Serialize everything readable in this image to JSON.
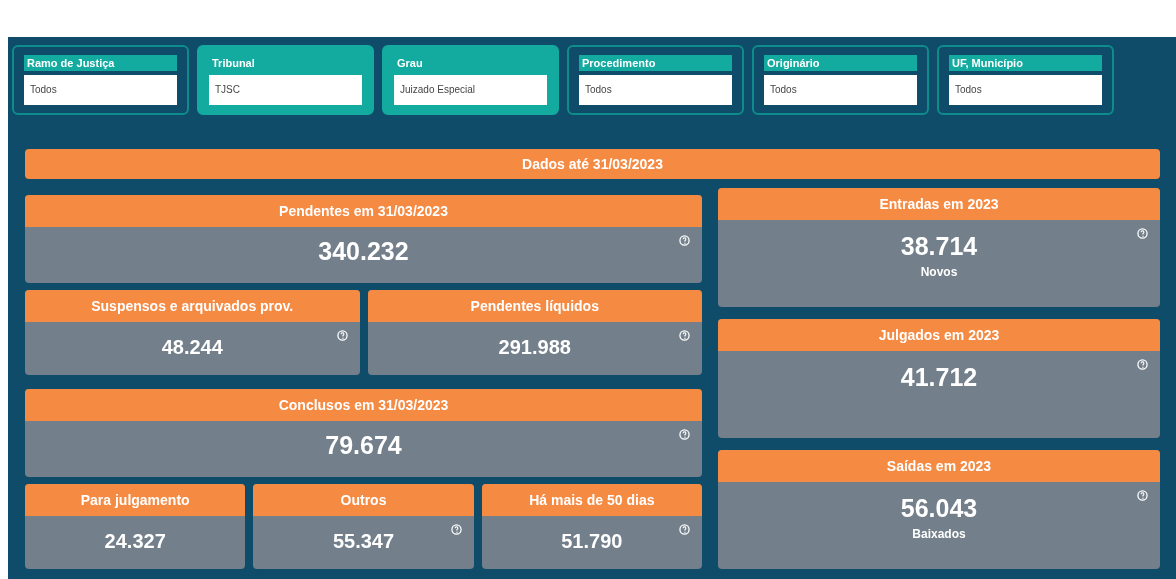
{
  "filters": [
    {
      "label": "Ramo de Justiça",
      "value": "Todos",
      "active": false
    },
    {
      "label": "Tribunal",
      "value": "TJSC",
      "active": true
    },
    {
      "label": "Grau",
      "value": "Juizado Especial",
      "active": true
    },
    {
      "label": "Procedimento",
      "value": "Todos",
      "active": false
    },
    {
      "label": "Originário",
      "value": "Todos",
      "active": false
    },
    {
      "label": "UF, Município",
      "value": "Todos",
      "active": false
    }
  ],
  "date_banner": "Dados até 31/03/2023",
  "left_rows": [
    [
      {
        "title": "Pendentes em 31/03/2023",
        "value": "340.232",
        "kind": "wide",
        "help": true
      }
    ],
    [
      {
        "title": "Suspensos e arquivados prov.",
        "value": "48.244",
        "kind": "short",
        "help": true
      },
      {
        "title": "Pendentes líquidos",
        "value": "291.988",
        "kind": "short",
        "help": true
      }
    ],
    [
      {
        "title": "Conclusos em 31/03/2023",
        "value": "79.674",
        "kind": "wide",
        "help": true
      }
    ],
    [
      {
        "title": "Para julgamento",
        "value": "24.327",
        "kind": "short",
        "help": false
      },
      {
        "title": "Outros",
        "value": "55.347",
        "kind": "short",
        "help": true
      },
      {
        "title": "Há mais de 50 dias",
        "value": "51.790",
        "kind": "short",
        "help": true
      }
    ]
  ],
  "right_cards": [
    {
      "title": "Entradas em 2023",
      "value": "38.714",
      "subtitle": "Novos",
      "help": true
    },
    {
      "title": "Julgados em 2023",
      "value": "41.712",
      "help": true
    },
    {
      "title": "Saídas em 2023",
      "value": "56.043",
      "subtitle": "Baixados",
      "help": true
    }
  ]
}
